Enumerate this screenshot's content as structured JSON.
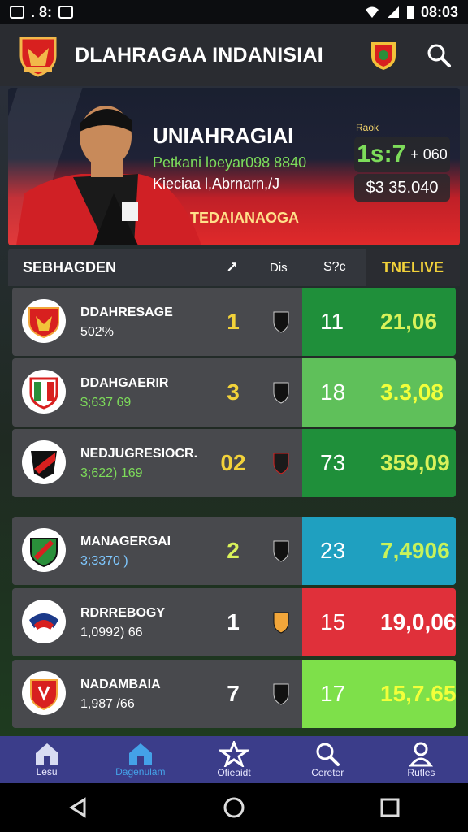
{
  "status": {
    "time": "08:03",
    "left_text": ". 8:"
  },
  "app": {
    "title": "DLAHRAGAA INDANISIAI"
  },
  "hero": {
    "title": "UNIAHRAGIAI",
    "line1": "Petkani loeyar098 8840",
    "line2": "Kieciaa l,Abrnarn,/J",
    "label": "TEDAIANAOGA",
    "small": "Raok",
    "score_big": "1s:7",
    "score_small": "+ 060",
    "score2": "$3 35.040"
  },
  "table": {
    "headers": {
      "team": "SEBHAGDEN",
      "arrow": "↗",
      "dg": "Dis",
      "sc": "S?c",
      "rel": "TNELIVE"
    },
    "rows": [
      {
        "name": "DDAHRESAGE",
        "sub": "502%",
        "rank": "1",
        "a": "11",
        "b": "21,06",
        "rank_color": "#f2d23a",
        "sub_color": "#ffffff",
        "cell_color": "#1f8f3a",
        "b_color": "#d9f25a"
      },
      {
        "name": "DDAHGAERIR",
        "sub": "$;637 69",
        "rank": "3",
        "a": "18",
        "b": "3.3,08",
        "rank_color": "#f2d23a",
        "sub_color": "#7ddc5a",
        "cell_color": "#5fc05a",
        "b_color": "#f2ff3a"
      },
      {
        "name": "NEDJUGRESIOCR.",
        "sub": "3;622) 169",
        "rank": "02",
        "a": "73",
        "b": "359,09",
        "rank_color": "#f2d23a",
        "sub_color": "#7ddc5a",
        "cell_color": "#1f8f3a",
        "b_color": "#d9f25a"
      },
      {
        "name": "MANAGERGAI",
        "sub": "3;3370 )",
        "rank": "2",
        "a": "23",
        "b": "7,4906",
        "rank_color": "#d9f25a",
        "sub_color": "#7fc8ff",
        "cell_color": "#1fa0c0",
        "b_color": "#c8f25a"
      },
      {
        "name": "RDRREBOGY",
        "sub": "1,0992) 66",
        "rank": "1",
        "a": "15",
        "b": "19,0,06",
        "rank_color": "#ffffff",
        "sub_color": "#ffffff",
        "cell_color": "#e0303a",
        "b_color": "#ffffff"
      },
      {
        "name": "NADAMBAIA",
        "sub": "1,987 /66",
        "rank": "7",
        "a": "17",
        "b": "15,7.65",
        "rank_color": "#ffffff",
        "sub_color": "#ffffff",
        "cell_color": "#7ee04a",
        "b_color": "#f2ff3a"
      }
    ]
  },
  "nav": [
    {
      "label": "Lesu",
      "icon": "home-icon"
    },
    {
      "label": "Dagenulam",
      "icon": "home-active-icon"
    },
    {
      "label": "Ofieaidt",
      "icon": "star-icon"
    },
    {
      "label": "Cereter",
      "icon": "search-icon"
    },
    {
      "label": "Rutles",
      "icon": "user-icon"
    }
  ]
}
